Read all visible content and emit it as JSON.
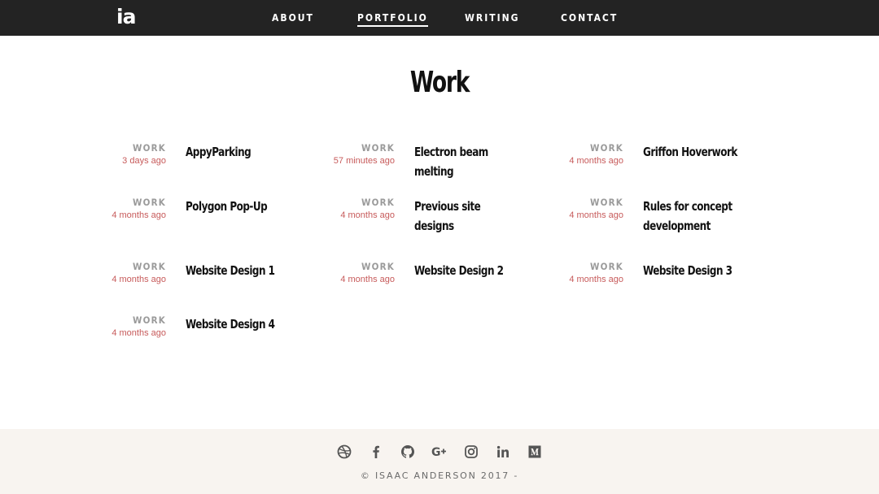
{
  "header": {
    "logo": "ia",
    "nav": [
      {
        "label": "ABOUT",
        "active": false
      },
      {
        "label": "PORTFOLIO",
        "active": true
      },
      {
        "label": "WRITING",
        "active": false
      },
      {
        "label": "CONTACT",
        "active": false
      }
    ]
  },
  "main": {
    "title": "Work",
    "entries": [
      {
        "tag": "WORK",
        "time": "3 days ago",
        "title": "AppyParking"
      },
      {
        "tag": "WORK",
        "time": "57 minutes ago",
        "title": "Electron beam melting"
      },
      {
        "tag": "WORK",
        "time": "4 months ago",
        "title": "Griffon Hoverwork"
      },
      {
        "tag": "WORK",
        "time": "4 months ago",
        "title": "Polygon Pop-Up"
      },
      {
        "tag": "WORK",
        "time": "4 months ago",
        "title": "Previous site designs"
      },
      {
        "tag": "WORK",
        "time": "4 months ago",
        "title": "Rules for concept development"
      },
      {
        "tag": "WORK",
        "time": "4 months ago",
        "title": "Website Design 1"
      },
      {
        "tag": "WORK",
        "time": "4 months ago",
        "title": "Website Design 2"
      },
      {
        "tag": "WORK",
        "time": "4 months ago",
        "title": "Website Design 3"
      },
      {
        "tag": "WORK",
        "time": "4 months ago",
        "title": "Website Design 4"
      }
    ]
  },
  "footer": {
    "social_icons": [
      "dribbble-icon",
      "facebook-icon",
      "github-icon",
      "google-plus-icon",
      "instagram-icon",
      "linkedin-icon",
      "medium-icon"
    ],
    "copyright": "© ISAAC ANDERSON 2017 -"
  },
  "colors": {
    "header_bg": "#232323",
    "footer_bg": "#f8f4f0",
    "time_accent": "#c75b5b",
    "tag_gray": "#9a9a9a"
  }
}
